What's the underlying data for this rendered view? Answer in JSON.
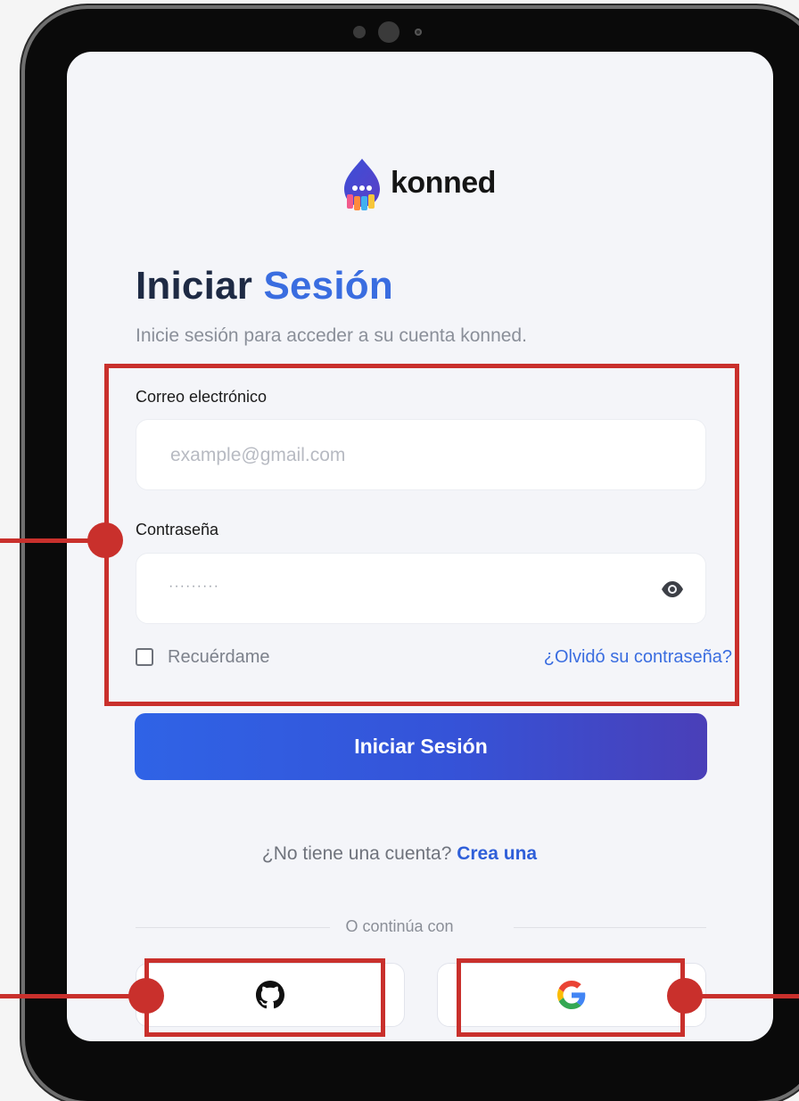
{
  "brand": {
    "name": "konned"
  },
  "heading": {
    "part1": "Iniciar",
    "part2": "Sesión"
  },
  "subtitle": "Inicie sesión para acceder a su cuenta konned.",
  "form": {
    "email_label": "Correo electrónico",
    "email_placeholder": "example@gmail.com",
    "password_label": "Contraseña",
    "password_mask": "·········",
    "remember_label": "Recuérdame",
    "forgot_link": "¿Olvidó su contraseña?",
    "submit_label": "Iniciar Sesión"
  },
  "signup": {
    "prompt": "¿No tiene una cuenta?",
    "link": "Crea una"
  },
  "divider": "O continúa con",
  "social": [
    {
      "provider": "GitHub",
      "icon": "github-icon"
    },
    {
      "provider": "Google",
      "icon": "google-icon"
    }
  ],
  "colors": {
    "accent": "#3a6de0",
    "heading": "#1e2a44",
    "annotation": "#c9302c",
    "button_gradient_start": "#2f63e6",
    "button_gradient_end": "#4a3fb8"
  }
}
